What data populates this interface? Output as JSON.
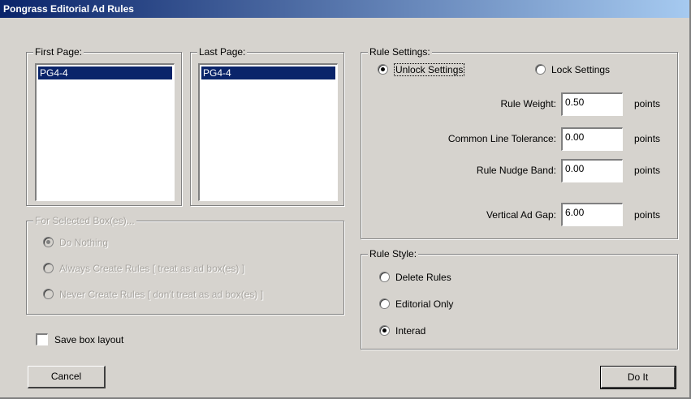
{
  "window": {
    "title": "Pongrass Editorial Ad Rules"
  },
  "first_page": {
    "legend": "First Page:",
    "items": [
      "PG4-4"
    ]
  },
  "last_page": {
    "legend": "Last Page:",
    "items": [
      "PG4-4"
    ]
  },
  "selected_boxes": {
    "legend": "For Selected Box(es)...",
    "options": [
      {
        "label": "Do Nothing",
        "checked": true
      },
      {
        "label": "Always Create Rules [ treat as ad box(es) ]",
        "checked": false
      },
      {
        "label": "Never Create Rules [ don't treat as ad box(es) ]",
        "checked": false
      }
    ]
  },
  "save_layout": {
    "label": "Save box layout",
    "checked": false
  },
  "rule_settings": {
    "legend": "Rule Settings:",
    "unlock_label": "Unlock Settings",
    "lock_label": "Lock Settings",
    "selected": "Unlock Settings",
    "fields": [
      {
        "label": "Rule Weight:",
        "value": "0.50",
        "units": "points"
      },
      {
        "label": "Common Line Tolerance:",
        "value": "0.00",
        "units": "points"
      },
      {
        "label": "Rule Nudge Band:",
        "value": "0.00",
        "units": "points"
      },
      {
        "label": "Vertical Ad Gap:",
        "value": "6.00",
        "units": "points"
      }
    ]
  },
  "rule_style": {
    "legend": "Rule Style:",
    "options": [
      {
        "label": "Delete Rules",
        "checked": false
      },
      {
        "label": "Editorial Only",
        "checked": false
      },
      {
        "label": "Interad",
        "checked": true
      }
    ]
  },
  "buttons": {
    "cancel": "Cancel",
    "do_it": "Do It"
  }
}
